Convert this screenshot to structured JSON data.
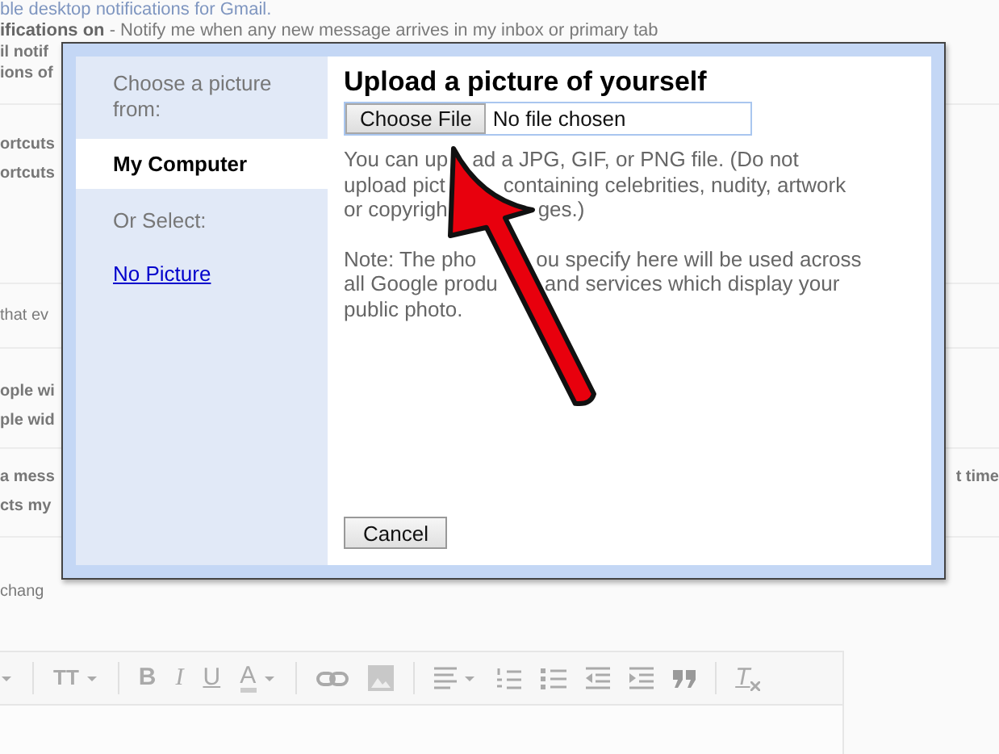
{
  "settings_page": {
    "sections": [
      {
        "lines": [
          {
            "kind": "link",
            "text": "ble desktop notifications for Gmail."
          },
          {
            "kind": "mixed",
            "text": "**ifications on** - Notify me when any new message arrives in my inbox or primary tab"
          },
          {
            "kind": "label",
            "text": "il notif"
          },
          {
            "kind": "label",
            "text": "ions of"
          }
        ]
      },
      {
        "lines": [
          {
            "kind": "label",
            "text": "ortcuts"
          },
          {
            "kind": "label",
            "text": "ortcuts"
          }
        ]
      },
      {
        "lines": [
          {
            "kind": "note",
            "text": "that ev"
          }
        ]
      },
      {
        "lines": [
          {
            "kind": "label",
            "text": "ople wi"
          },
          {
            "kind": "label",
            "text": "ple wid"
          }
        ]
      },
      {
        "lines": [
          {
            "kind": "label",
            "text": "a mess",
            "right": "t time"
          },
          {
            "kind": "label",
            "text": "cts my"
          }
        ]
      },
      {
        "lines": [
          {
            "kind": "note",
            "text": "chang"
          }
        ]
      }
    ]
  },
  "editor_toolbar": [
    {
      "kind": "caret"
    },
    {
      "kind": "sep"
    },
    {
      "kind": "fontsize",
      "glyph": "TT"
    },
    {
      "kind": "caret"
    },
    {
      "kind": "sep"
    },
    {
      "kind": "bold",
      "glyph": "B"
    },
    {
      "kind": "italic",
      "glyph": "I"
    },
    {
      "kind": "underline",
      "glyph": "U"
    },
    {
      "kind": "color",
      "glyph": "A"
    },
    {
      "kind": "caret"
    },
    {
      "kind": "sep"
    },
    {
      "kind": "link"
    },
    {
      "kind": "image"
    },
    {
      "kind": "sep"
    },
    {
      "kind": "align"
    },
    {
      "kind": "caret"
    },
    {
      "kind": "ol"
    },
    {
      "kind": "ul"
    },
    {
      "kind": "outdent"
    },
    {
      "kind": "indent"
    },
    {
      "kind": "quote"
    },
    {
      "kind": "sep"
    },
    {
      "kind": "clear",
      "glyph": "T"
    }
  ],
  "dialog": {
    "title": "Upload a picture of yourself",
    "sidebar": {
      "heading": "Choose a picture from:",
      "items": [
        {
          "kind": "tab",
          "label": "My Computer",
          "selected": true
        },
        {
          "kind": "heading",
          "label": "Or Select:"
        },
        {
          "kind": "link",
          "label": "No Picture"
        }
      ]
    },
    "file_input": {
      "button": "Choose File",
      "value": "No file chosen"
    },
    "paragraphs": [
      {
        "lines": [
          [
            "You can up",
            "ad a JPG, GIF, or PNG file. (Do not"
          ],
          [
            "upload pict",
            "containing celebrities, nudity, artwork"
          ],
          [
            "or copyrigh",
            "ges.)"
          ]
        ]
      },
      {
        "lines": [
          [
            "Note: The pho",
            "ou specify here will be used across"
          ],
          [
            "all Google produ",
            "and services which display your"
          ],
          [
            "public photo."
          ]
        ]
      }
    ],
    "cancel": "Cancel"
  },
  "annotation": {
    "kind": "arrow"
  }
}
